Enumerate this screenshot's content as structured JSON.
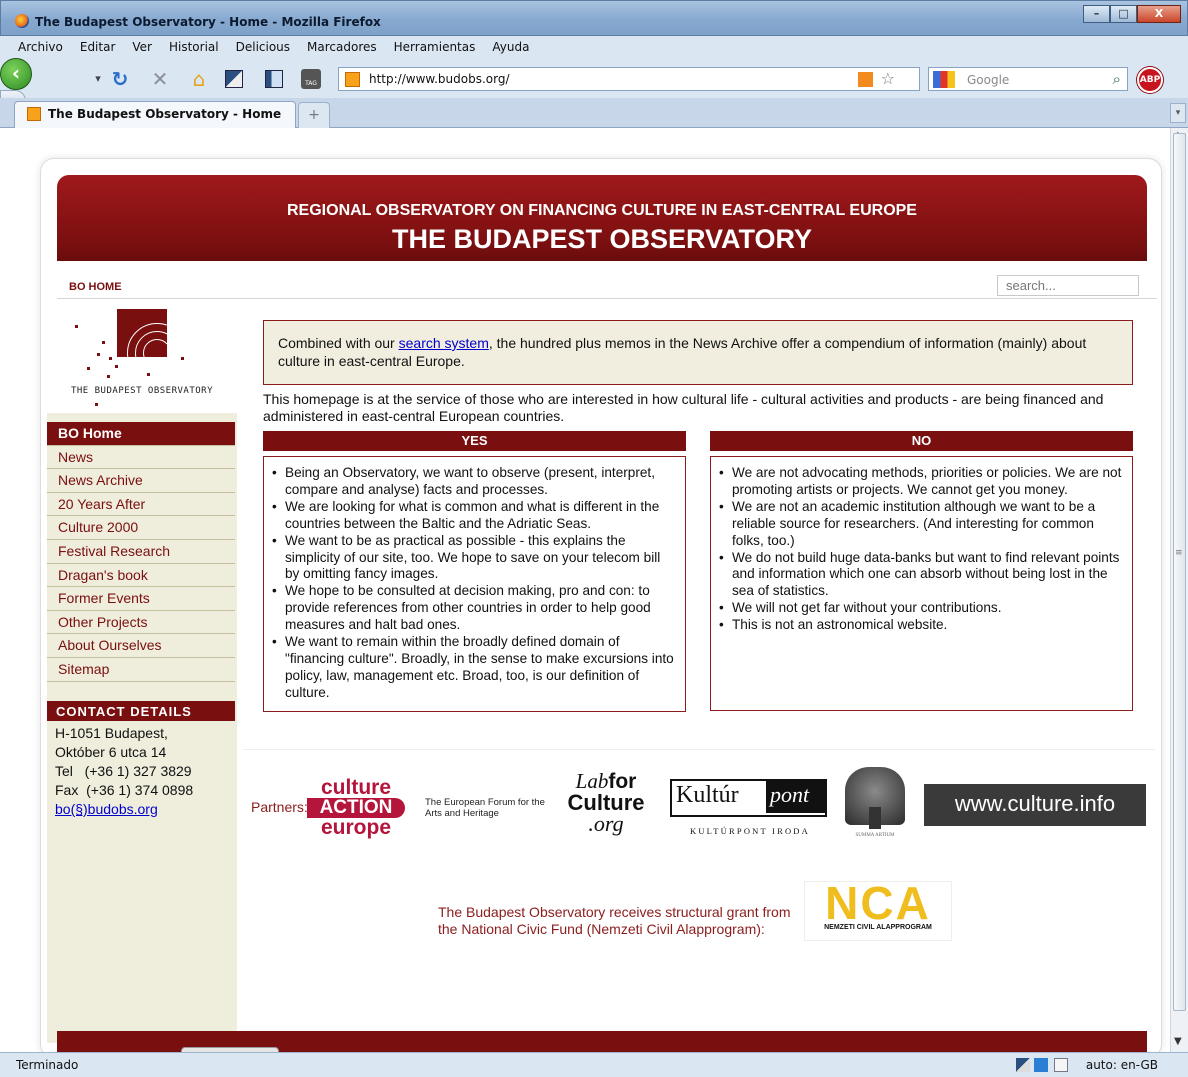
{
  "window": {
    "title": "The Budapest Observatory - Home - Mozilla Firefox",
    "buttons": [
      "–",
      "□",
      "X"
    ]
  },
  "menubar": [
    "Archivo",
    "Editar",
    "Ver",
    "Historial",
    "Delicious",
    "Marcadores",
    "Herramientas",
    "Ayuda"
  ],
  "navbar": {
    "url": "http://www.budobs.org/",
    "search_placeholder": "Google",
    "adblock_label": "ABP"
  },
  "tabs": {
    "active": "The Budapest Observatory - Home",
    "new_tab": "+"
  },
  "banner": {
    "subtitle": "REGIONAL OBSERVATORY ON FINANCING CULTURE IN EAST-CENTRAL EUROPE",
    "title": "THE BUDAPEST OBSERVATORY"
  },
  "topnav": {
    "home_link": "BO HOME",
    "search_placeholder": "search..."
  },
  "sidebar": {
    "logo_text": "THE BUDAPEST OBSERVATORY",
    "items": [
      {
        "label": "BO Home",
        "active": true
      },
      {
        "label": "News"
      },
      {
        "label": "News Archive"
      },
      {
        "label": "20 Years After"
      },
      {
        "label": "Culture 2000"
      },
      {
        "label": "Festival Research"
      },
      {
        "label": "Dragan's book"
      },
      {
        "label": "Former Events"
      },
      {
        "label": "Other Projects"
      },
      {
        "label": "About Ourselves"
      },
      {
        "label": "Sitemap"
      }
    ],
    "contact": {
      "header": "CONTACT DETAILS",
      "address1": "H-1051 Budapest,",
      "address2": "Október 6 utca 14",
      "tel": "Tel   (+36 1) 327 3829",
      "fax": "Fax  (+36 1) 374 0898",
      "email": "bo(§)budobs.org"
    }
  },
  "intro": {
    "before_link": "Combined with our ",
    "link": "search system",
    "after_link": ", the hundred plus memos in the News Archive offer a compendium of information (mainly) about culture in east-central Europe."
  },
  "lead": "This homepage is at the service of those who are interested in how cultural life - cultural activities and products - are being financed and administered in east-central European countries.",
  "yes_panel": {
    "header": "YES",
    "items": [
      "Being an Observatory, we want to observe (present, interpret, compare and analyse) facts and processes.",
      "We are looking for what is common and what is different in the countries between the Baltic and the Adriatic Seas.",
      "We want to be as practical as possible - this explains the simplicity of our site, too. We hope to save on your telecom bill by omitting fancy images.",
      "We hope to be consulted at decision making, pro and con: to provide references from other countries in order to help good measures and halt bad ones.",
      "We want to remain within the broadly defined domain of \"financing culture\". Broadly, in the sense to make excursions into policy, law, management etc. Broad, too, is our definition of culture."
    ]
  },
  "no_panel": {
    "header": "NO",
    "items": [
      "We are not advocating methods, priorities or policies. We are not promoting artists or projects. We cannot get you money.",
      "We are not an academic institution although we want to be a reliable source for researchers. (And interesting for common folks, too.)",
      "We do not build huge data-banks but want to find relevant points and information which one can absorb without being lost in the sea of statistics.",
      "We will not get far without your contributions.",
      "This is not an astronomical website."
    ]
  },
  "partners": {
    "label": "Partners:",
    "cae": [
      "culture",
      "ACTION",
      "europe"
    ],
    "efah": "The European Forum for the Arts and Heritage",
    "lab": {
      "l1": "Lab",
      "l1b": "for",
      "l2": "Culture",
      "l3": ".org"
    },
    "kultur": {
      "word": "Kultúr",
      "pont": "pont",
      "foot": "KULTÚRPONT IRODA"
    },
    "tree_caption": "SUMMA ARTIUM",
    "wcul": "www.culture.info",
    "grant": "The Budapest Observatory receives structural grant from the National Civic Fund (Nemzeti Civil Alapprogram):",
    "nca_big": "NCA",
    "nca_small": "NEMZETI CIVIL ALAPPROGRAM"
  },
  "statusbar": {
    "status": "Terminado",
    "lang": "auto: en-GB"
  }
}
